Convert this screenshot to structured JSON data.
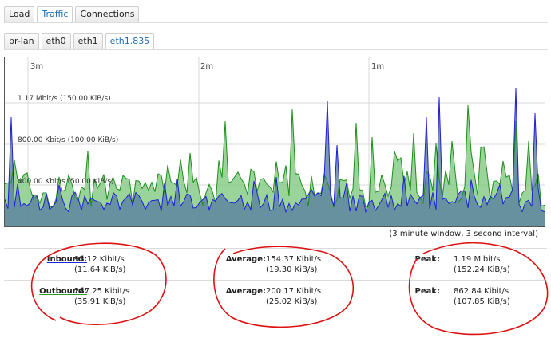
{
  "tabs": [
    {
      "label": "Load",
      "active": false
    },
    {
      "label": "Traffic",
      "active": true
    },
    {
      "label": "Connections",
      "active": false
    }
  ],
  "interfaces": [
    {
      "label": "br-lan",
      "active": false
    },
    {
      "label": "eth0",
      "active": false
    },
    {
      "label": "eth1",
      "active": false
    },
    {
      "label": "eth1.835",
      "active": true
    }
  ],
  "graph": {
    "time_labels": [
      "3m",
      "2m",
      "1m"
    ],
    "y_labels": [
      "1.17 Mbit/s (150.00 KiB/s)",
      "800.00 Kbit/s (100.00 KiB/s)",
      "400.00 Kbit/s (50.00 KiB/s)"
    ],
    "window_note": "(3 minute window, 3 second interval)",
    "colors": {
      "inbound": "#1f1fd6",
      "outbound": "#1d8f1d",
      "fill_outbound": "#88cc88",
      "fill_inbound": "#5a7fa0"
    }
  },
  "stats": {
    "inbound": {
      "label": "Inbound:",
      "kbit": "93.12 Kibit/s",
      "kib": "(11.64 KiB/s)"
    },
    "outbound": {
      "label": "Outbound:",
      "kbit": "287.25 Kibit/s",
      "kib": "(35.91 KiB/s)"
    },
    "avg_in": {
      "label": "Average:",
      "kbit": "154.37 Kibit/s",
      "kib": "(19.30 KiB/s)"
    },
    "avg_out": {
      "label": "Average:",
      "kbit": "200.17 Kibit/s",
      "kib": "(25.02 KiB/s)"
    },
    "peak_in": {
      "label": "Peak:",
      "kbit": "1.19 Mibit/s",
      "kib": "(152.24 KiB/s)"
    },
    "peak_out": {
      "label": "Peak:",
      "kbit": "862.84 Kibit/s",
      "kib": "(107.85 KiB/s)"
    }
  }
}
